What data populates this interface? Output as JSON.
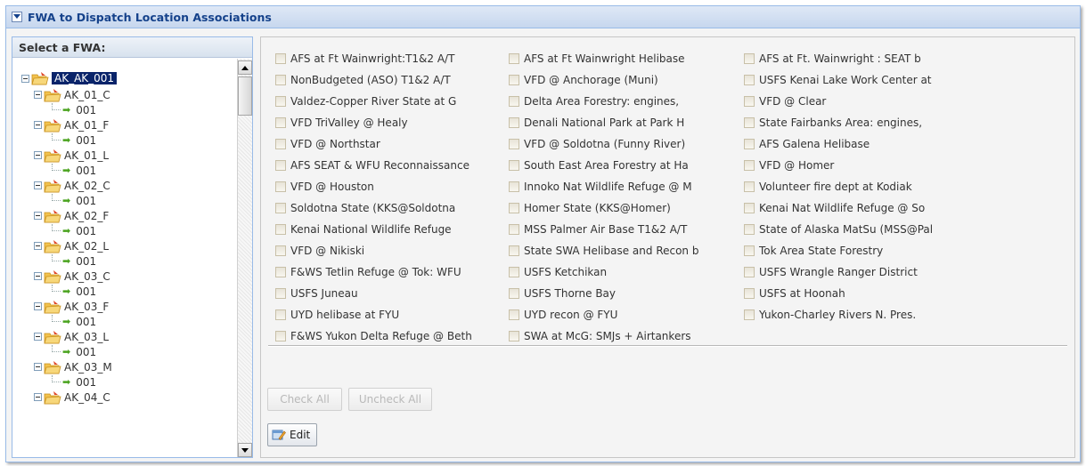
{
  "window": {
    "title": "FWA to Dispatch Location Associations",
    "collapse_icon": "chevron-down-icon"
  },
  "fwa_panel": {
    "title": "Select a FWA:",
    "root": {
      "label": "AK_AK_001",
      "selected": true
    },
    "nodes": [
      {
        "label": "AK_01_C",
        "child": "001"
      },
      {
        "label": "AK_01_F",
        "child": "001"
      },
      {
        "label": "AK_01_L",
        "child": "001"
      },
      {
        "label": "AK_02_C",
        "child": "001"
      },
      {
        "label": "AK_02_F",
        "child": "001"
      },
      {
        "label": "AK_02_L",
        "child": "001"
      },
      {
        "label": "AK_03_C",
        "child": "001"
      },
      {
        "label": "AK_03_F",
        "child": "001"
      },
      {
        "label": "AK_03_L",
        "child": "001"
      },
      {
        "label": "AK_03_M",
        "child": "001"
      },
      {
        "label": "AK_04_C",
        "child": ""
      }
    ]
  },
  "locations": [
    {
      "label": "AFS at Ft Wainwright:T1&2 A/T",
      "checked": false
    },
    {
      "label": "AFS at Ft Wainwright Helibase",
      "checked": false
    },
    {
      "label": "AFS at Ft. Wainwright : SEAT b",
      "checked": false
    },
    {
      "label": "NonBudgeted (ASO) T1&2 A/T",
      "checked": false
    },
    {
      "label": "VFD @ Anchorage (Muni)",
      "checked": false
    },
    {
      "label": "USFS Kenai Lake Work Center at",
      "checked": false
    },
    {
      "label": "Valdez-Copper River State at G",
      "checked": false
    },
    {
      "label": "Delta Area Forestry: engines,",
      "checked": false
    },
    {
      "label": "VFD @ Clear",
      "checked": false
    },
    {
      "label": "VFD TriValley @ Healy",
      "checked": false
    },
    {
      "label": "Denali National Park at Park H",
      "checked": false
    },
    {
      "label": "State Fairbanks Area: engines,",
      "checked": false
    },
    {
      "label": "VFD @ Northstar",
      "checked": false
    },
    {
      "label": "VFD @ Soldotna (Funny River)",
      "checked": false
    },
    {
      "label": "AFS Galena Helibase",
      "checked": false
    },
    {
      "label": "AFS SEAT & WFU Reconnaissance",
      "checked": false
    },
    {
      "label": "South East Area Forestry at Ha",
      "checked": false
    },
    {
      "label": "VFD @ Homer",
      "checked": false
    },
    {
      "label": "VFD @ Houston",
      "checked": false
    },
    {
      "label": "Innoko Nat Wildlife Refuge @ M",
      "checked": false
    },
    {
      "label": "Volunteer fire dept at Kodiak",
      "checked": false
    },
    {
      "label": "Soldotna State (KKS@Soldotna",
      "checked": false
    },
    {
      "label": "Homer State (KKS@Homer)",
      "checked": false
    },
    {
      "label": "Kenai Nat Wildlife Refuge @ So",
      "checked": false
    },
    {
      "label": "Kenai National Wildlife Refuge",
      "checked": false
    },
    {
      "label": "MSS Palmer Air Base T1&2 A/T",
      "checked": false
    },
    {
      "label": "State of Alaska MatSu (MSS@Pal",
      "checked": false
    },
    {
      "label": "VFD @ Nikiski",
      "checked": false
    },
    {
      "label": "State SWA Helibase and Recon b",
      "checked": false
    },
    {
      "label": "Tok Area State Forestry",
      "checked": false
    },
    {
      "label": "F&WS Tetlin Refuge @ Tok: WFU",
      "checked": false
    },
    {
      "label": "USFS Ketchikan",
      "checked": false
    },
    {
      "label": "USFS Wrangle Ranger District",
      "checked": false
    },
    {
      "label": "USFS Juneau",
      "checked": false
    },
    {
      "label": "USFS Thorne Bay",
      "checked": false
    },
    {
      "label": "USFS at Hoonah",
      "checked": false
    },
    {
      "label": "UYD helibase at FYU",
      "checked": false
    },
    {
      "label": "UYD recon @ FYU",
      "checked": false
    },
    {
      "label": "Yukon-Charley Rivers N. Pres.",
      "checked": false
    },
    {
      "label": "F&WS Yukon Delta Refuge @ Beth",
      "checked": false
    },
    {
      "label": "SWA at McG: SMJs + Airtankers",
      "checked": false
    }
  ],
  "buttons": {
    "check_all": {
      "label": "Check All",
      "enabled": false
    },
    "uncheck_all": {
      "label": "Uncheck All",
      "enabled": false
    },
    "edit": {
      "label": "Edit",
      "icon": "edit-icon",
      "enabled": true
    }
  }
}
